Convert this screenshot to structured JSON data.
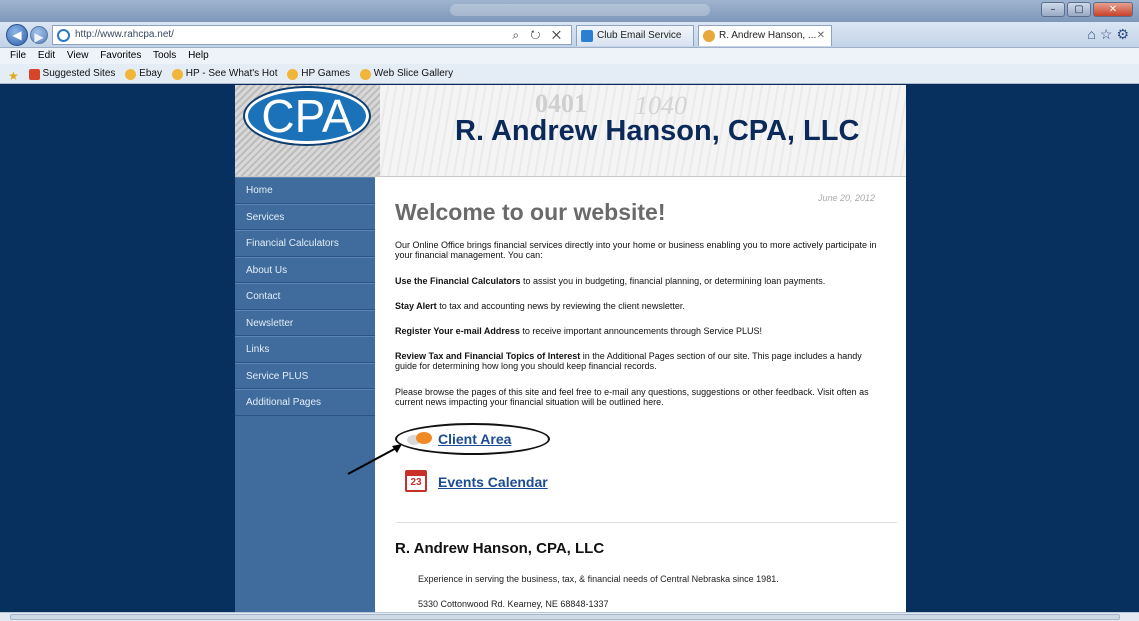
{
  "browser": {
    "address": "http://www.rahcpa.net/",
    "tabs": [
      {
        "label": "Club Email Service"
      },
      {
        "label": "R. Andrew Hanson, ..."
      }
    ],
    "menu": [
      "File",
      "Edit",
      "View",
      "Favorites",
      "Tools",
      "Help"
    ],
    "favorites": [
      "Suggested Sites",
      "Ebay",
      "HP - See What's Hot",
      "HP Games",
      "Web Slice Gallery"
    ]
  },
  "site": {
    "logo": "CPA",
    "title": "R. Andrew Hanson, CPA, LLC",
    "nav": [
      "Home",
      "Services",
      "Financial Calculators",
      "About Us",
      "Contact",
      "Newsletter",
      "Links",
      "Service PLUS",
      "Additional Pages"
    ],
    "date": "June 20, 2012",
    "welcome": "Welcome to our website!",
    "intro": "Our Online Office brings financial services directly into your home or business enabling you to more actively participate in your financial management. You can:",
    "bullets": [
      {
        "bold": "Use the Financial Calculators",
        "text": " to assist you in budgeting, financial planning, or determining loan payments."
      },
      {
        "bold": "Stay Alert",
        "text": " to tax and accounting news by reviewing the client newsletter."
      },
      {
        "bold": "Register Your e-mail Address",
        "text": " to receive important announcements through Service PLUS!"
      },
      {
        "bold": "Review Tax and Financial Topics of Interest",
        "text": " in the Additional Pages section of our site. This page includes a handy guide for determining how long you should keep financial records."
      }
    ],
    "closing": "Please browse the pages of this site and feel free to e-mail any questions, suggestions or other feedback. Visit often as current news impacting your financial situation will be outlined here.",
    "client_area": "Client Area",
    "events_calendar": "Events Calendar",
    "calendar_day": "23",
    "footer": {
      "title": "R. Andrew Hanson, CPA, LLC",
      "tagline": "Experience in serving the business, tax, & financial needs of Central Nebraska since 1981.",
      "address": "5330 Cottonwood Rd. Kearney, NE  68848-1337"
    }
  }
}
